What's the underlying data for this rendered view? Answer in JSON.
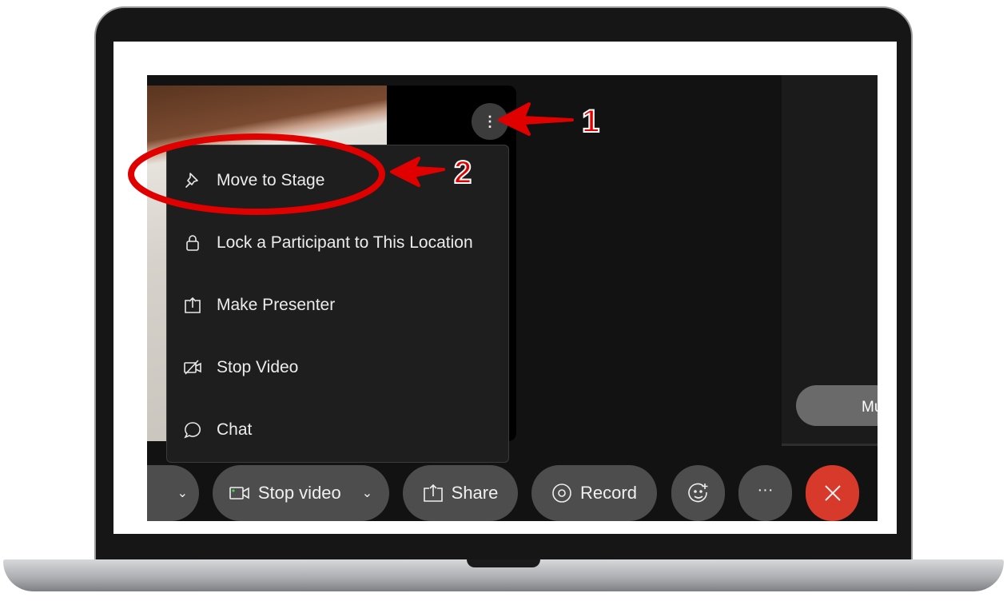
{
  "menu": {
    "items": [
      {
        "label": "Move to Stage",
        "icon": "pin-icon"
      },
      {
        "label": "Lock a Participant to This Location",
        "icon": "lock-icon"
      },
      {
        "label": "Make Presenter",
        "icon": "share-up-icon"
      },
      {
        "label": "Stop Video",
        "icon": "video-off-icon"
      },
      {
        "label": "Chat",
        "icon": "chat-bubble-icon"
      }
    ]
  },
  "right_panel": {
    "button_label": "Mu"
  },
  "toolbar": {
    "stop_video": "Stop video",
    "share": "Share",
    "record": "Record",
    "end_color": "#d73a2b"
  },
  "annotations": {
    "step1": "1",
    "step2": "2",
    "color": "#e00000"
  }
}
